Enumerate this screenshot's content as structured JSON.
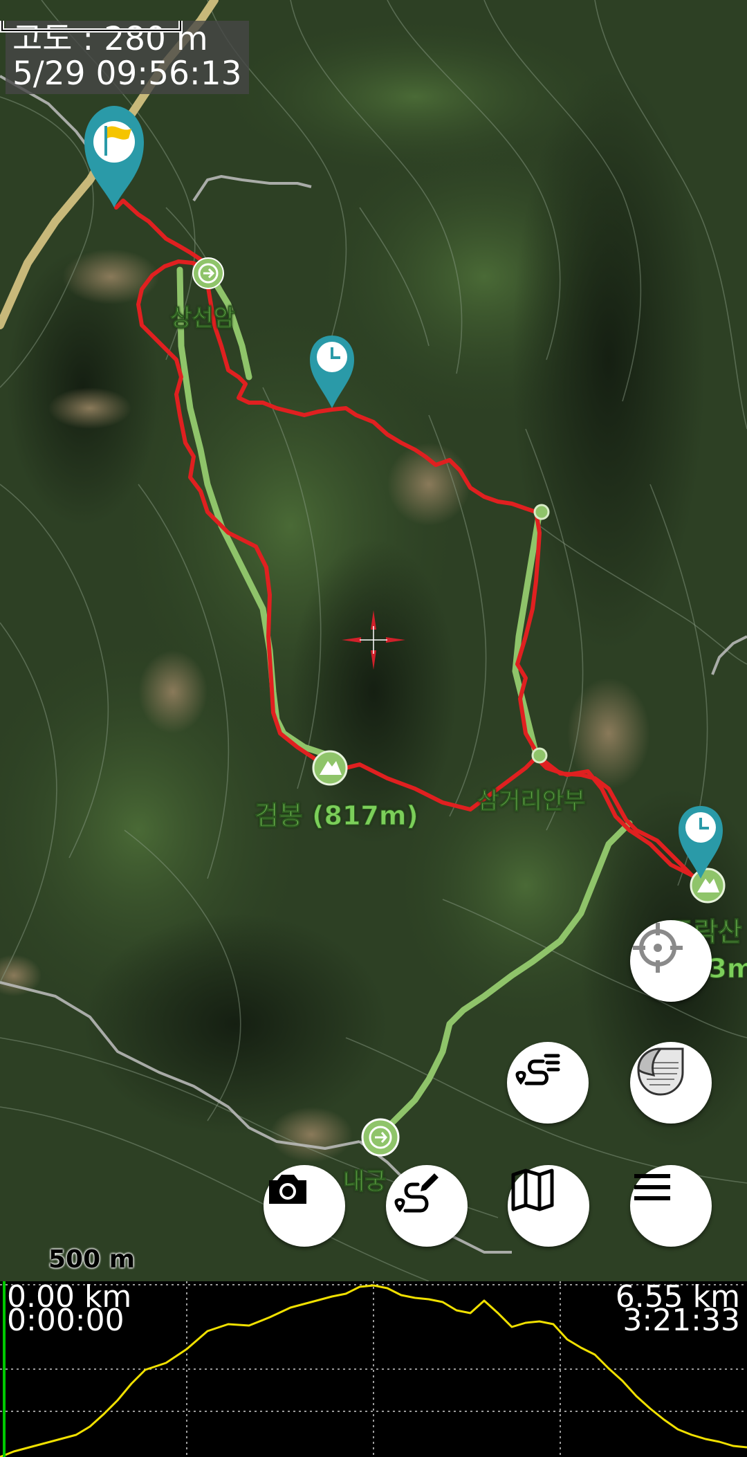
{
  "info": {
    "altitude": "고도 : 280 m",
    "time": "5/29 09:56:13"
  },
  "labels": {
    "sangseonam": "상선암",
    "geombong": "검봉 (817m)",
    "samgeori": "삼거리안부",
    "dorak_partial": "도락산",
    "dorak_elev_partial": ".3m",
    "naegung_partial": "내궁"
  },
  "scale": {
    "label": "500 m"
  },
  "profile": {
    "start_distance": "0.00 km",
    "start_time": "0:00:00",
    "end_distance": "6.55 km",
    "end_time": "3:21:33"
  },
  "icons": {
    "start_marker": "flag-pin-icon",
    "waypoint_marker": "clock-pin-icon",
    "crosshair": "map-center-crosshair-icon",
    "locate": "locate-crosshair-icon",
    "route_list": "route-list-icon",
    "layers": "layer-peel-icon",
    "camera": "camera-icon",
    "route_edit": "route-edit-icon",
    "map": "map-fold-icon",
    "menu": "hamburger-menu-icon"
  },
  "colors": {
    "track": "#e02020",
    "trail": "#8fc46a",
    "marker": "#2a9aa8",
    "elevation_line": "#f0e000"
  }
}
